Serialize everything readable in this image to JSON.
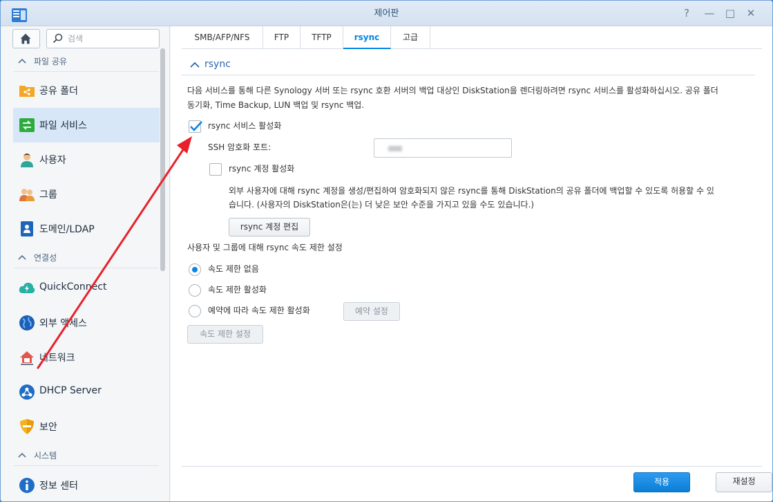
{
  "window": {
    "title": "제어판"
  },
  "search": {
    "placeholder": "검색"
  },
  "sidebar": {
    "sections": [
      {
        "label": "파일 공유"
      },
      {
        "label": "연결성"
      },
      {
        "label": "시스템"
      }
    ],
    "items": [
      {
        "label": "공유 폴더",
        "icon": "shared-folder-icon"
      },
      {
        "label": "파일 서비스",
        "icon": "file-services-icon"
      },
      {
        "label": "사용자",
        "icon": "user-icon"
      },
      {
        "label": "그룹",
        "icon": "group-icon"
      },
      {
        "label": "도메인/LDAP",
        "icon": "domain-ldap-icon"
      },
      {
        "label": "QuickConnect",
        "icon": "quickconnect-icon"
      },
      {
        "label": "외부 액세스",
        "icon": "external-access-icon"
      },
      {
        "label": "네트워크",
        "icon": "network-icon"
      },
      {
        "label": "DHCP Server",
        "icon": "dhcp-server-icon"
      },
      {
        "label": "보안",
        "icon": "security-shield-icon"
      },
      {
        "label": "정보 센터",
        "icon": "info-center-icon"
      }
    ]
  },
  "tabs": [
    "SMB/AFP/NFS",
    "FTP",
    "TFTP",
    "rsync",
    "고급"
  ],
  "active_tab": "rsync",
  "section": {
    "title": "rsync",
    "description_line1": "다음 서비스를 통해 다른 Synology 서버 또는 rsync 호환 서버의 백업 대상인 DiskStation을 렌더링하려면 rsync 서비스를 활성화하십시오. 공유 폴더",
    "description_line2": "동기화, Time Backup, LUN 백업 및 rsync 백업."
  },
  "settings": {
    "enable_rsync_label": "rsync 서비스 활성화",
    "enable_rsync_checked": true,
    "ssh_port_label": "SSH 암호화 포트:",
    "ssh_port_value": "",
    "enable_account_label": "rsync 계정 활성화",
    "enable_account_checked": false,
    "account_desc_line1": "외부 사용자에 대해 rsync 계정을 생성/편집하여 암호화되지 않은 rsync를 통해 DiskStation의 공유 폴더에 백업할 수 있도록 허용할 수 있",
    "account_desc_line2": "습니다. (사용자의 DiskStation은(는) 더 낮은 보안 수준을 가지고 있을 수도 있습니다.)",
    "edit_account_button": "rsync 계정 편집",
    "speed_limit_heading": "사용자 및 그룹에 대해 rsync 속도 제한 설정",
    "speed_options": [
      "속도 제한 없음",
      "속도 제한 활성화",
      "예약에 따라 속도 제한 활성화"
    ],
    "speed_selected": 0,
    "schedule_button": "예약 설정",
    "speed_settings_button": "속도 제한 설정"
  },
  "footer": {
    "apply": "적용",
    "reset": "재설정"
  },
  "colors": {
    "accent": "#0086e5",
    "arrow": "#e8202a"
  }
}
